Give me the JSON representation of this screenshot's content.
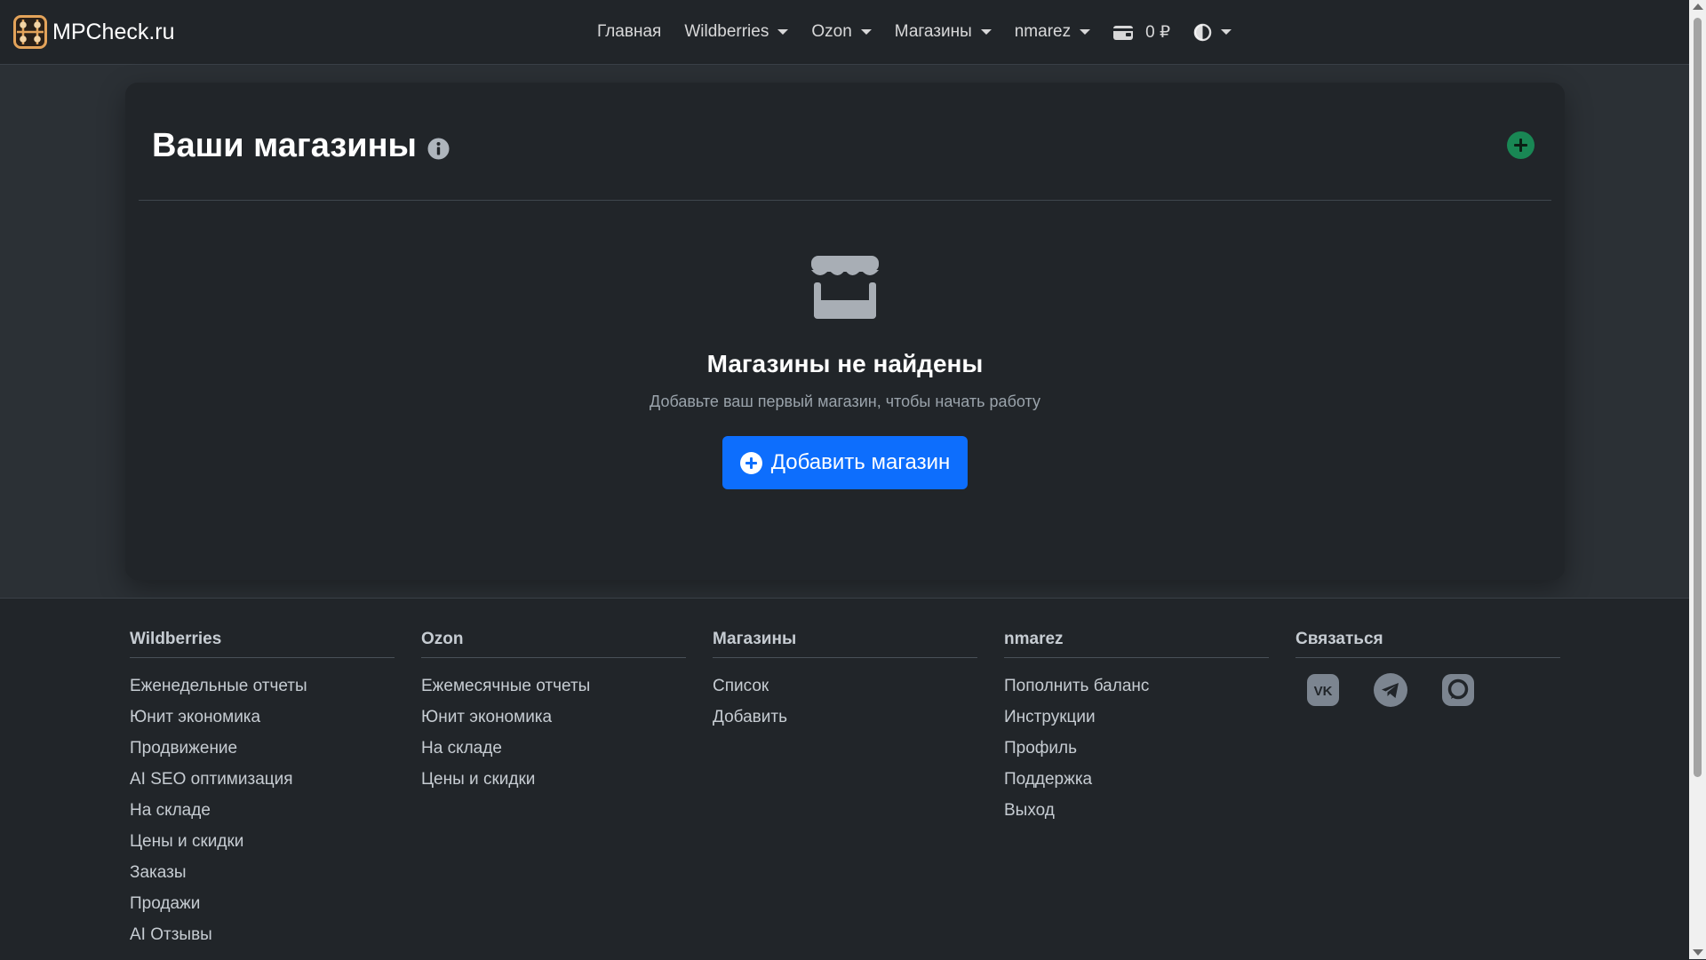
{
  "brand": {
    "name": "MPCheck.ru"
  },
  "nav": {
    "home": "Главная",
    "wildberries": "Wildberries",
    "ozon": "Ozon",
    "stores": "Магазины",
    "user": "nmarez",
    "balance": "0 ₽"
  },
  "card": {
    "title": "Ваши магазины",
    "empty_title": "Магазины не найдены",
    "empty_subtitle": "Добавьте ваш первый магазин, чтобы начать работу",
    "add_button": "Добавить магазин"
  },
  "footer": {
    "wildberries": {
      "heading": "Wildberries",
      "links": [
        "Еженедельные отчеты",
        "Юнит экономика",
        "Продвижение",
        "AI SEO оптимизация",
        "На складе",
        "Цены и скидки",
        "Заказы",
        "Продажи",
        "AI Отзывы"
      ]
    },
    "ozon": {
      "heading": "Ozon",
      "links": [
        "Ежемесячные отчеты",
        "Юнит экономика",
        "На складе",
        "Цены и скидки"
      ]
    },
    "stores": {
      "heading": "Магазины",
      "links": [
        "Список",
        "Добавить"
      ]
    },
    "user": {
      "heading": "nmarez",
      "links": [
        "Пополнить баланс",
        "Инструкции",
        "Профиль",
        "Поддержка",
        "Выход"
      ]
    },
    "contact": {
      "heading": "Связаться",
      "icons": [
        "vk-icon",
        "telegram-icon",
        "max-messenger-icon"
      ]
    }
  },
  "colors": {
    "primary": "#0d6efd",
    "success": "#198754",
    "background": "#2b3035",
    "surface": "#212529"
  }
}
